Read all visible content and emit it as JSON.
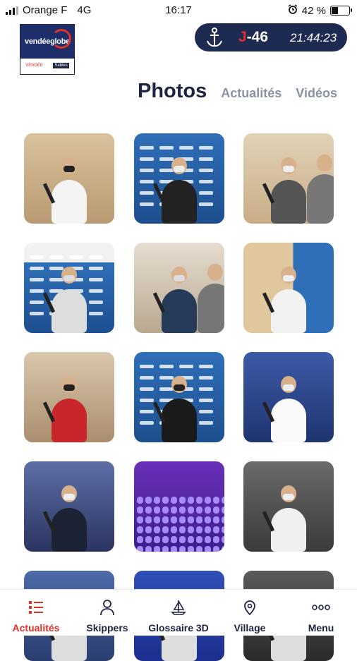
{
  "status_bar": {
    "carrier": "Orange F",
    "network": "4G",
    "time": "16:17",
    "battery": "42 %",
    "battery_level": 0.42
  },
  "logo": {
    "brand": "vendéeglobe",
    "sponsor_left": "VENDÉE",
    "sponsor_right": "Sables"
  },
  "countdown": {
    "days_prefix": "J",
    "days_value": "-46",
    "time": "21:44:23"
  },
  "tabs": {
    "active": "Photos",
    "items": [
      "Actualités",
      "Vidéos"
    ]
  },
  "colors": {
    "navy": "#1d2a52",
    "accent_red": "#e0302c",
    "tab_inactive": "#8a93a4"
  },
  "photos": [
    {
      "scene": "interview-sailor-white-shirt"
    },
    {
      "scene": "woman-press-backdrop"
    },
    {
      "scene": "press-group-interview"
    },
    {
      "scene": "cameraman-backdrop"
    },
    {
      "scene": "room-interview-cameras"
    },
    {
      "scene": "sailor-microphones"
    },
    {
      "scene": "red-shirt-interview"
    },
    {
      "scene": "black-shirt-backdrop"
    },
    {
      "scene": "sailor-stage-mic"
    },
    {
      "scene": "stage-speaker-blue"
    },
    {
      "scene": "audience-purple-light"
    },
    {
      "scene": "speaker-white-shirt"
    },
    {
      "scene": "partial-1"
    },
    {
      "scene": "partial-2"
    },
    {
      "scene": "partial-3"
    }
  ],
  "bottom_nav": [
    {
      "label": "Actualités",
      "icon": "news-list-icon",
      "active": true
    },
    {
      "label": "Skippers",
      "icon": "person-icon",
      "active": false
    },
    {
      "label": "Glossaire 3D",
      "icon": "sailboat-icon",
      "active": false
    },
    {
      "label": "Village",
      "icon": "map-pin-icon",
      "active": false
    },
    {
      "label": "Menu",
      "icon": "dots-menu-icon",
      "active": false
    }
  ]
}
